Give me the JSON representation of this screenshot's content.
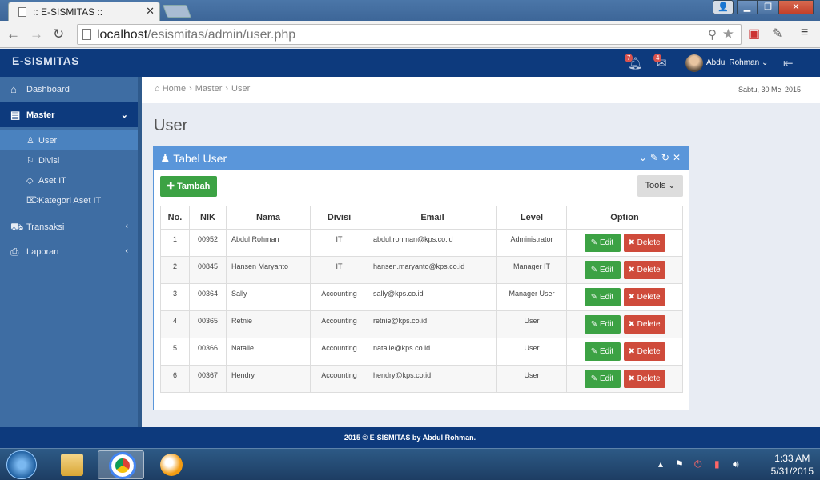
{
  "browser": {
    "tab_title": ":: E-SISMITAS ::",
    "url_host": "localhost",
    "url_path": "/esismitas/admin/user.php"
  },
  "app": {
    "brand": "E-SISMITAS",
    "notif_count": "7",
    "mail_count": "4",
    "user_name": "Abdul Rohman"
  },
  "sidebar": {
    "dashboard": "Dashboard",
    "master": "Master",
    "sub": [
      "User",
      "Divisi",
      "Aset IT",
      "Kategori Aset IT"
    ],
    "transaksi": "Transaksi",
    "laporan": "Laporan"
  },
  "breadcrumb": [
    "Home",
    "Master",
    "User"
  ],
  "date": "Sabtu, 30 Mei 2015",
  "page_title": "User",
  "panel": {
    "title": "Tabel User",
    "add_label": "Tambah",
    "tools_label": "Tools"
  },
  "table": {
    "headers": [
      "No.",
      "NIK",
      "Nama",
      "Divisi",
      "Email",
      "Level",
      "Option"
    ],
    "rows": [
      {
        "no": "1",
        "nik": "00952",
        "nama": "Abdul Rohman",
        "divisi": "IT",
        "email": "abdul.rohman@kps.co.id",
        "level": "Administrator"
      },
      {
        "no": "2",
        "nik": "00845",
        "nama": "Hansen Maryanto",
        "divisi": "IT",
        "email": "hansen.maryanto@kps.co.id",
        "level": "Manager IT"
      },
      {
        "no": "3",
        "nik": "00364",
        "nama": "Sally",
        "divisi": "Accounting",
        "email": "sally@kps.co.id",
        "level": "Manager User"
      },
      {
        "no": "4",
        "nik": "00365",
        "nama": "Retnie",
        "divisi": "Accounting",
        "email": "retnie@kps.co.id",
        "level": "User"
      },
      {
        "no": "5",
        "nik": "00366",
        "nama": "Natalie",
        "divisi": "Accounting",
        "email": "natalie@kps.co.id",
        "level": "User"
      },
      {
        "no": "6",
        "nik": "00367",
        "nama": "Hendry",
        "divisi": "Accounting",
        "email": "hendry@kps.co.id",
        "level": "User"
      }
    ],
    "edit_label": "Edit",
    "delete_label": "Delete"
  },
  "footer": "2015 © E-SISMITAS by Abdul Rohman.",
  "taskbar": {
    "time": "1:33 AM",
    "date": "5/31/2015"
  }
}
